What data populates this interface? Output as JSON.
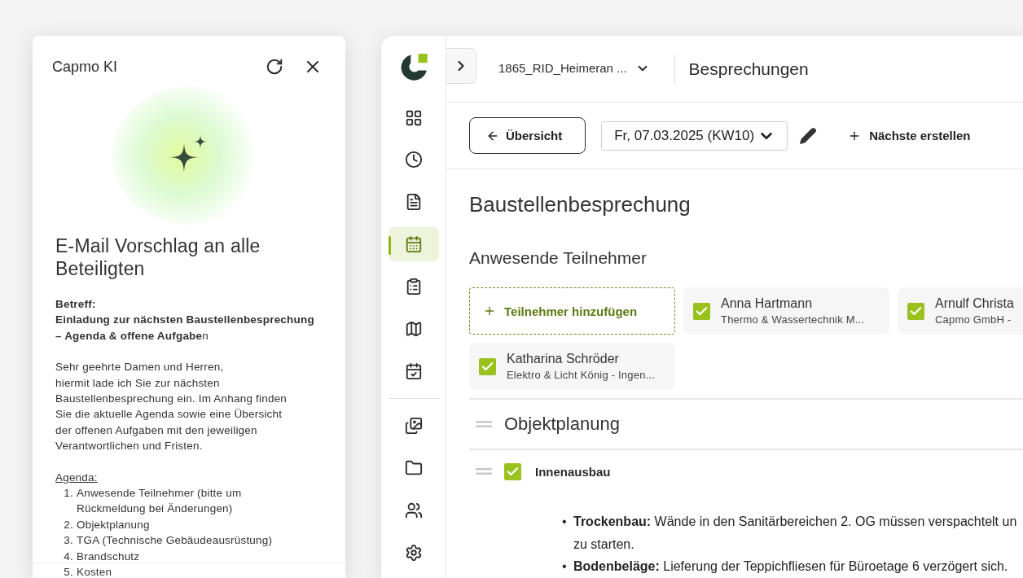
{
  "assistant": {
    "title": "Capmo KI",
    "heading": "E-Mail Vorschlag an alle Beteiligten",
    "subject_label": "Betreff:",
    "subject": "**Einladung zur nächsten Baustellenbesprechung**\n**– Agenda & offene Aufgabe**n",
    "greeting": "Sehr geehrte Damen und Herren,\nhiermit lade ich Sie zur nächsten\nBaustellenbesprechung ein. Im Anhang finden\nSie die aktuelle Agenda sowie eine Übersicht\nder offenen Aufgaben mit den jeweiligen\nVerantwortlichen und Fristen.",
    "agenda_label": "Agenda:",
    "agenda": [
      {
        "number": "1.",
        "text": "Anwesende Teilnehmer (bitte um\nRückmeldung bei Änderungen)"
      },
      {
        "number": "2.",
        "text": "Objektplanung"
      },
      {
        "number": "3.",
        "text": "TGA (Technische Gebäudeausrüstung)"
      },
      {
        "number": "4.",
        "text": "Brandschutz"
      },
      {
        "number": "5.",
        "text": "Kosten"
      }
    ]
  },
  "sidebar": {
    "items": [
      {
        "kind": "grid",
        "selected": false
      },
      {
        "kind": "clock",
        "selected": false
      },
      {
        "kind": "document",
        "selected": false
      },
      {
        "kind": "calendar",
        "selected": true
      },
      {
        "kind": "clipboard",
        "selected": false
      },
      {
        "kind": "map",
        "selected": false
      },
      {
        "kind": "calendar-check",
        "selected": false
      },
      {
        "kind": "divider"
      },
      {
        "kind": "images",
        "selected": false
      },
      {
        "kind": "folder",
        "selected": false
      },
      {
        "kind": "people",
        "selected": false
      },
      {
        "kind": "settings",
        "selected": false
      }
    ]
  },
  "header": {
    "project": "1865_RID_Heimeran ...",
    "title": "Besprechungen"
  },
  "toolbar": {
    "back": "Übersicht",
    "date": "Fr, 07.03.2025 (KW10)",
    "create": "Nächste erstellen"
  },
  "meeting": {
    "title": "Baustellenbesprechung",
    "participants_heading": "Anwesende Teilnehmer",
    "add_participant": "Teilnehmer hinzufügen",
    "participants": [
      {
        "name": "Anna Hartmann",
        "company": "Thermo & Wassertechnik M...",
        "checked": true
      },
      {
        "name": "Arnulf Christa",
        "company": "Capmo GmbH -",
        "checked": true
      },
      {
        "name": "Katharina Schröder",
        "company": "Elektro & Licht König - Ingen...",
        "checked": true
      }
    ],
    "section": "Objektplanung",
    "topic": {
      "title": "Innenausbau",
      "checked": true
    },
    "bullets": [
      {
        "marker": "•",
        "text": "**Trockenbau:** Wände in den Sanitärbereichen 2. OG müssen verspachtelt un\nzu starten."
      },
      {
        "marker": "•",
        "text": "**Bodenbeläge:** Lieferung der Teppichfliesen für Büroetage 6 verzögert sich."
      }
    ]
  }
}
